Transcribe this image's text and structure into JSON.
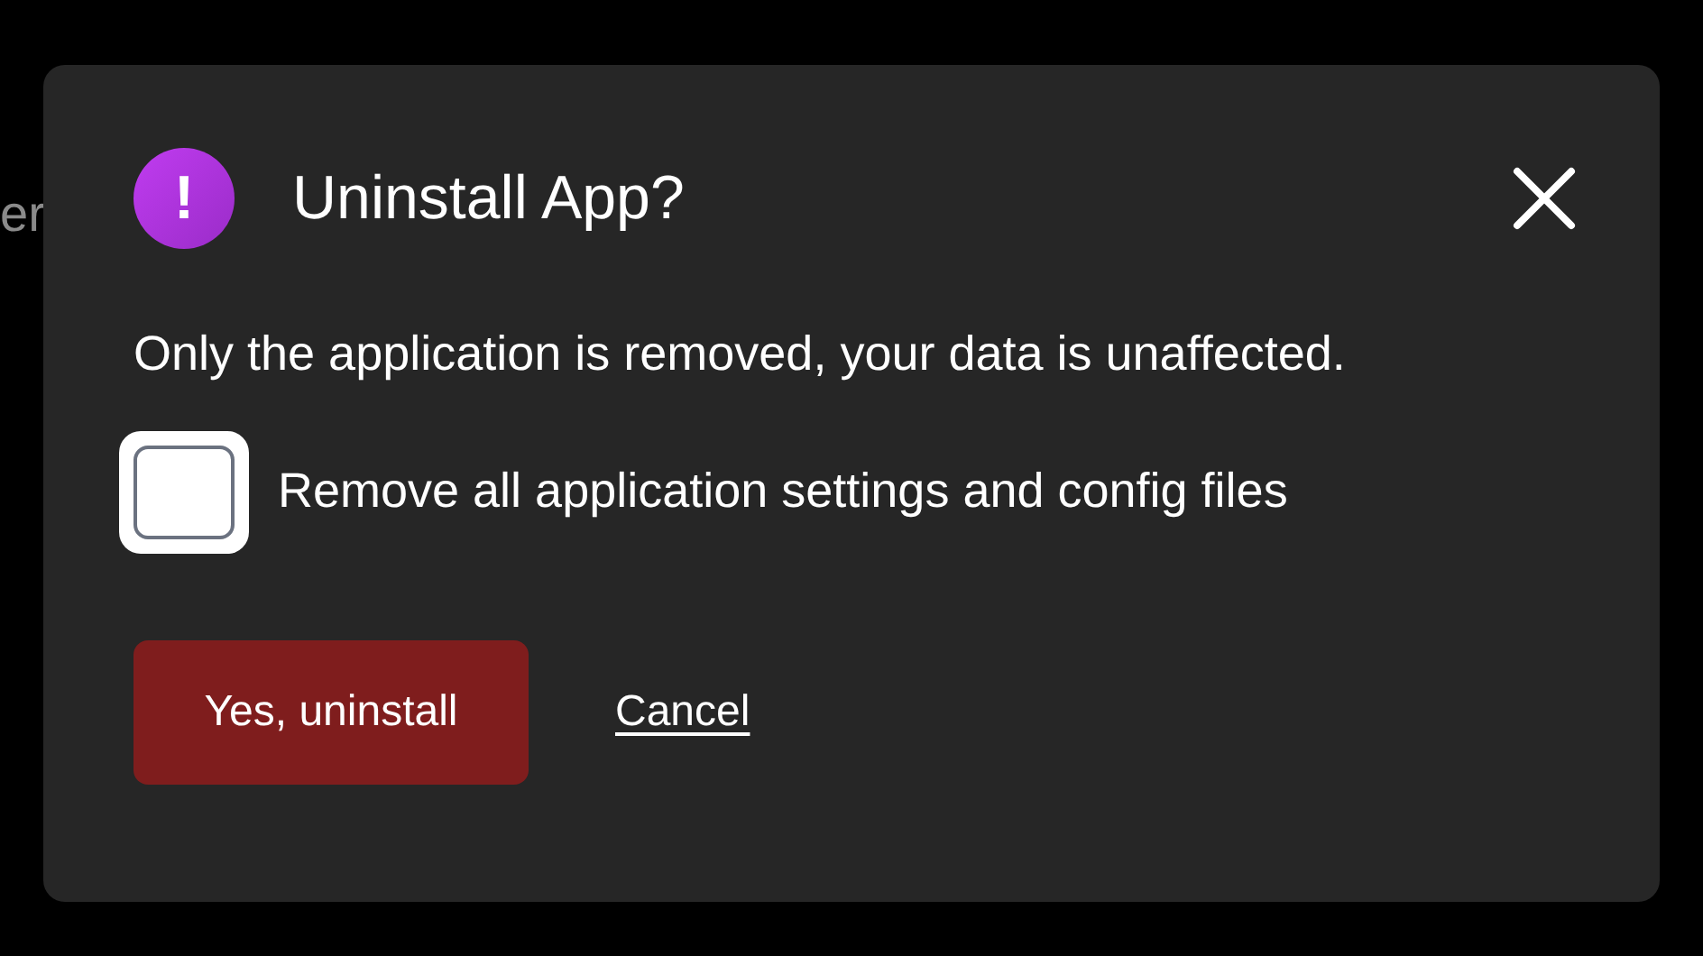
{
  "background_text": "er",
  "dialog": {
    "title": "Uninstall App?",
    "icon_glyph": "!",
    "message": "Only the application is removed, your data is unaffected.",
    "checkbox": {
      "label": "Remove all application settings and config files",
      "checked": false,
      "focused": true
    },
    "buttons": [
      {
        "kind": "primary",
        "label": "Yes, uninstall"
      },
      {
        "kind": "link",
        "label": "Cancel"
      }
    ]
  }
}
